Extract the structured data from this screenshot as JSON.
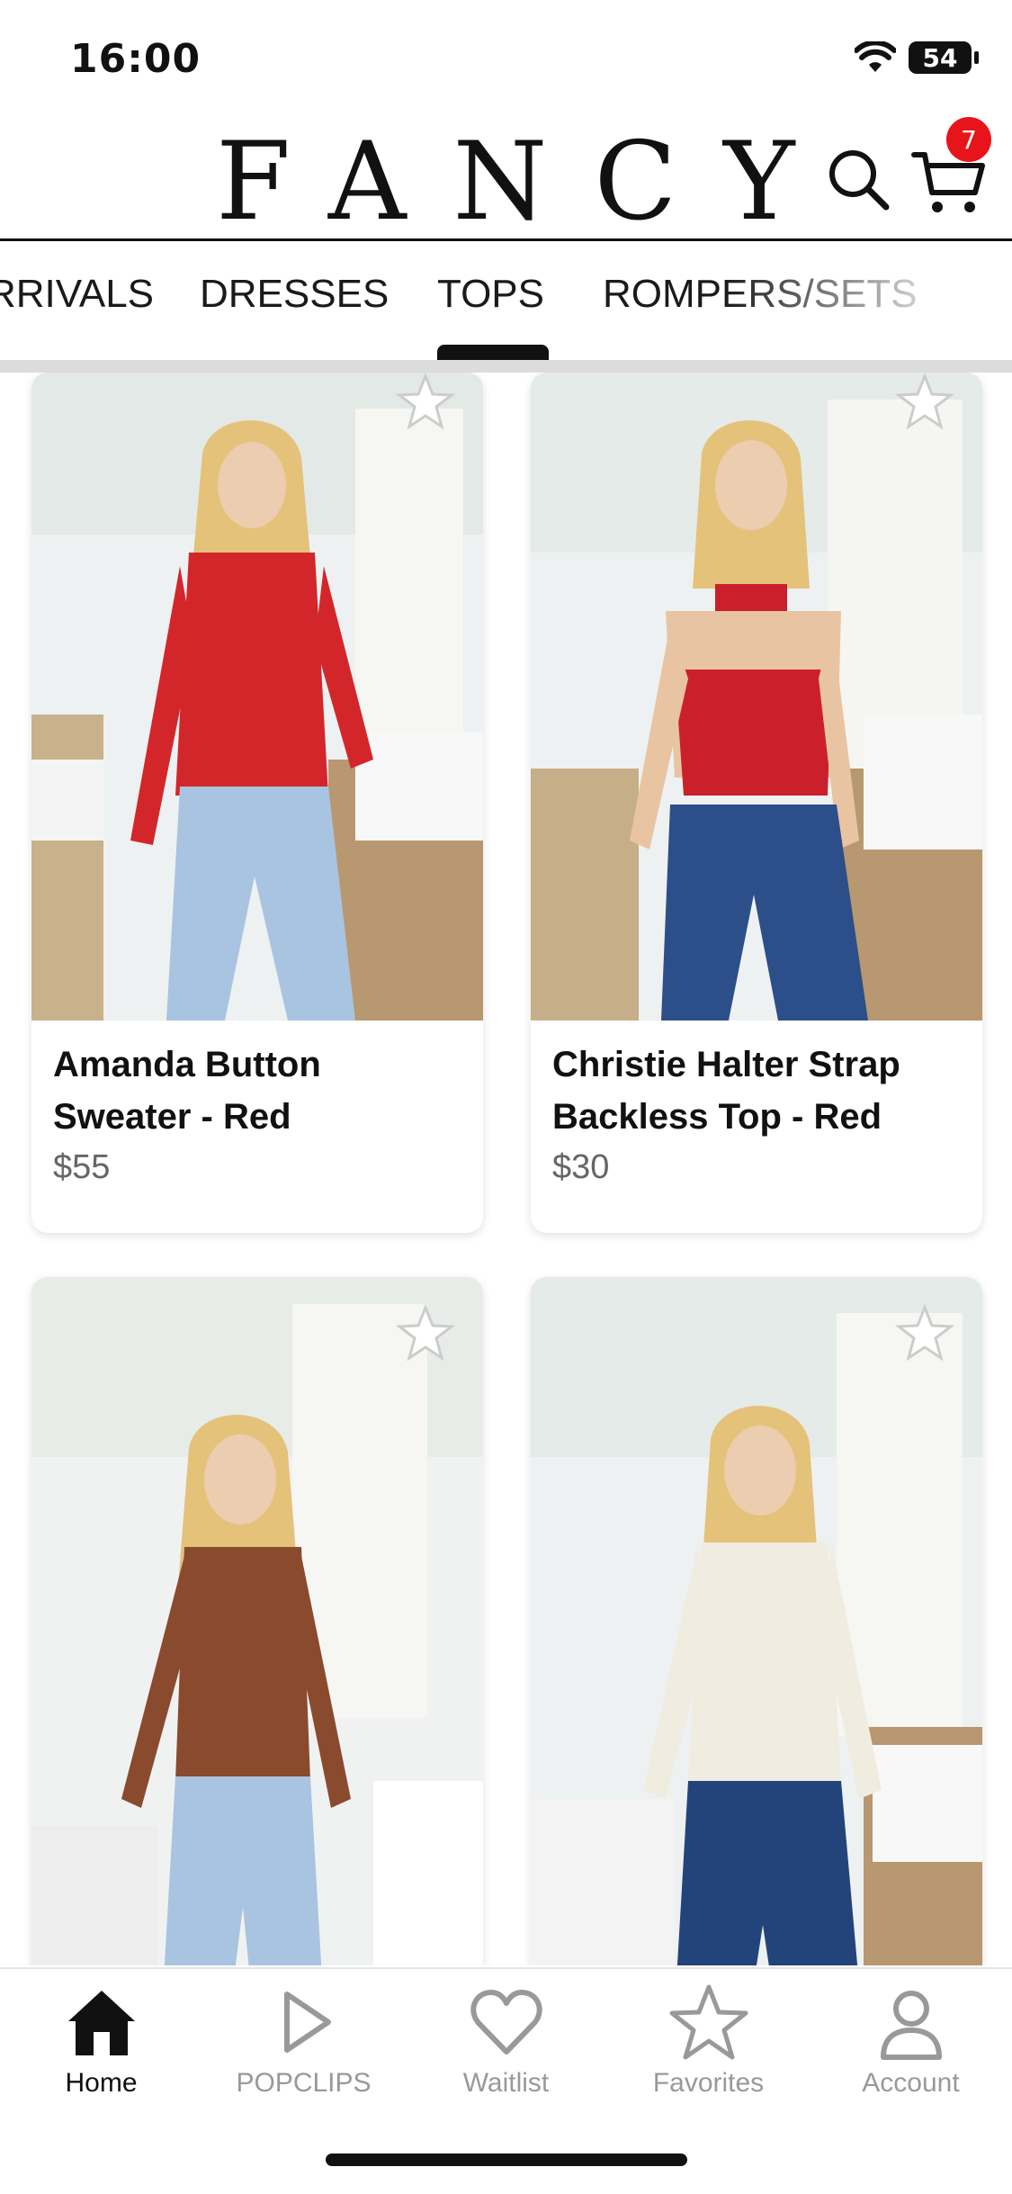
{
  "status_bar": {
    "time": "16:00",
    "battery": "54"
  },
  "header": {
    "logo": "FANCY",
    "cart_count": "7"
  },
  "categories": [
    {
      "label": "RRIVALS",
      "active": false
    },
    {
      "label": "DRESSES",
      "active": false
    },
    {
      "label": "TOPS",
      "active": true
    },
    {
      "label": "ROMPERS/SETS",
      "active": false
    }
  ],
  "products": [
    {
      "name": "Amanda Button Sweater - Red",
      "price": "$55",
      "top_color": "#d3262b",
      "pants_color": "#a9c4e0"
    },
    {
      "name": "Christie Halter Strap Backless Top - Red",
      "price": "$30",
      "top_color": "#cc1f2c",
      "pants_color": "#2c4f8a"
    },
    {
      "name": "",
      "price": "",
      "top_color": "#8a4a2e",
      "pants_color": "#a9c4e0"
    },
    {
      "name": "",
      "price": "",
      "top_color": "#f1ece0",
      "pants_color": "#22447a"
    }
  ],
  "tab_bar": {
    "items": [
      {
        "label": "Home",
        "icon": "home-icon",
        "active": true
      },
      {
        "label": "POPCLIPS",
        "icon": "play-icon",
        "active": false
      },
      {
        "label": "Waitlist",
        "icon": "heart-icon",
        "active": false
      },
      {
        "label": "Favorites",
        "icon": "star-icon",
        "active": false
      },
      {
        "label": "Account",
        "icon": "person-icon",
        "active": false
      }
    ]
  },
  "colors": {
    "accent": "#111111",
    "badge": "#e8141c",
    "inactive_tab": "#999999"
  }
}
